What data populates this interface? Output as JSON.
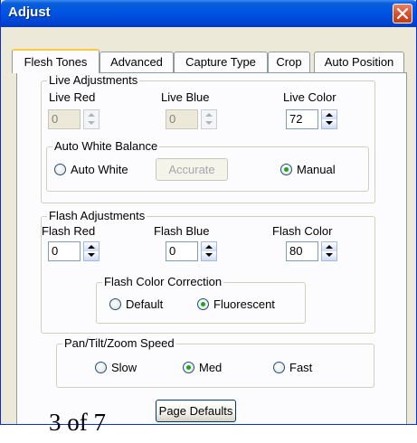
{
  "window": {
    "title": "Adjust"
  },
  "tabs": [
    "Flesh Tones",
    "Advanced",
    "Capture Type",
    "Crop",
    "Auto Position"
  ],
  "live": {
    "group_label": "Live Adjustments",
    "red_label": "Live Red",
    "red_value": "0",
    "blue_label": "Live Blue",
    "blue_value": "0",
    "color_label": "Live Color",
    "color_value": "72",
    "awb": {
      "group_label": "Auto White Balance",
      "auto_label": "Auto White",
      "accurate_label": "Accurate",
      "manual_label": "Manual",
      "selected": "Manual"
    }
  },
  "flash": {
    "group_label": "Flash Adjustments",
    "red_label": "Flash Red",
    "red_value": "0",
    "blue_label": "Flash Blue",
    "blue_value": "0",
    "color_label": "Flash Color",
    "color_value": "80",
    "correction": {
      "group_label": "Flash Color Correction",
      "default_label": "Default",
      "fluorescent_label": "Fluorescent",
      "selected": "Fluorescent"
    }
  },
  "ptz": {
    "group_label": "Pan/Tilt/Zoom Speed",
    "slow_label": "Slow",
    "med_label": "Med",
    "fast_label": "Fast",
    "selected": "Med"
  },
  "page_defaults_label": "Page Defaults",
  "page_number": "3 of 7"
}
